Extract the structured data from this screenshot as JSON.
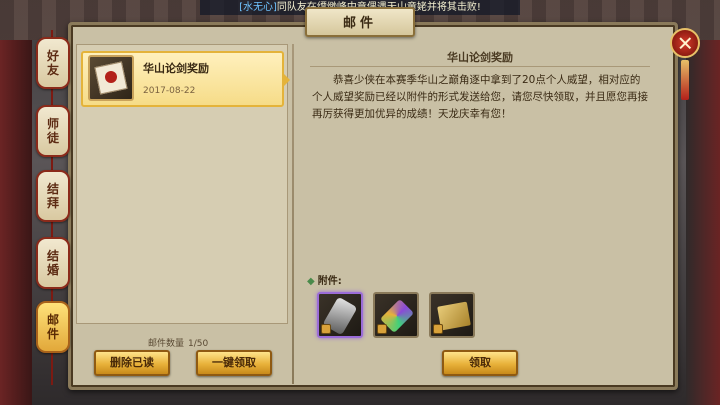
{
  "notice": {
    "player": "[水无心]",
    "message": "同队友在缥缈峰中竟偶遇天山童姥并将其击败!"
  },
  "window": {
    "title": "邮件",
    "close_glyph": "✕"
  },
  "tabs": [
    {
      "chars": [
        "好",
        "友"
      ],
      "active": false
    },
    {
      "chars": [
        "师",
        "徒"
      ],
      "active": false
    },
    {
      "chars": [
        "结",
        "拜"
      ],
      "active": false
    },
    {
      "chars": [
        "结",
        "婚"
      ],
      "active": false
    },
    {
      "chars": [
        "邮",
        "件"
      ],
      "active": true
    }
  ],
  "mail_list": {
    "items": [
      {
        "title": "华山论剑奖励",
        "date": "2017-08-22",
        "icon": "mail-envelope-icon"
      }
    ],
    "count_label": "邮件数量",
    "count_value": "1/50",
    "delete_read_label": "删除已读",
    "collect_all_label": "一键领取"
  },
  "mail_detail": {
    "title": "华山论剑奖励",
    "body": "恭喜少侠在本赛季华山之巅角逐中拿到了20点个人威望，相对应的个人威望奖励已经以附件的形式发送给您，请您尽快领取，并且愿您再接再厉获得更加优异的成绩！天龙庆幸有您！",
    "attachments_label": "附件:",
    "attachments": [
      {
        "icon": "stone-item-icon",
        "selected": true
      },
      {
        "icon": "gem-item-icon",
        "selected": false
      },
      {
        "icon": "scroll-item-icon",
        "selected": false
      }
    ],
    "claim_label": "领取"
  },
  "colors": {
    "accent_gold": "#e8b23a",
    "panel_bg": "#c9c0a5",
    "close_red": "#d63a2a",
    "notice_player": "#6fc3ff"
  }
}
